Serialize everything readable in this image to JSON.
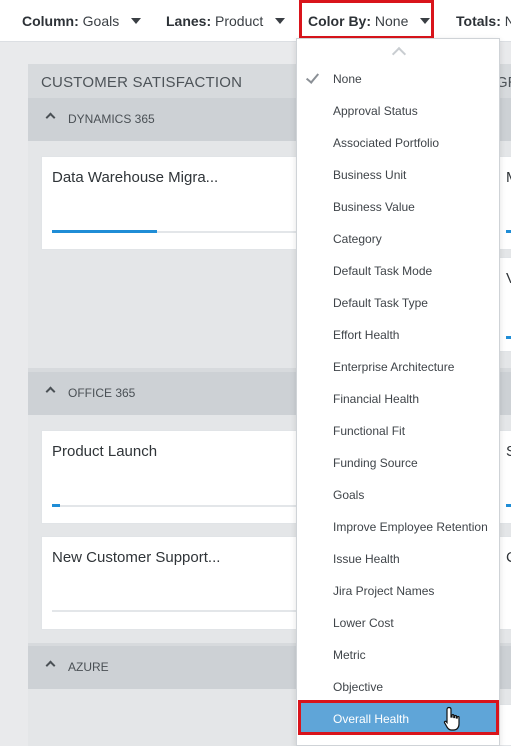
{
  "toolbar": {
    "column_label": "Column:",
    "column_value": "Goals",
    "lanes_label": "Lanes:",
    "lanes_value": "Product",
    "colorby_label": "Color By:",
    "colorby_value": "None",
    "totals_label": "Totals:",
    "totals_value": "N"
  },
  "columns": [
    {
      "title": "CUSTOMER SATISFACTION"
    },
    {
      "title": "GR"
    }
  ],
  "lanes": [
    {
      "label": "DYNAMICS 365",
      "cards": [
        {
          "title": "Data Warehouse Migra...",
          "progress": 0.42
        }
      ],
      "right_cards": [
        {
          "title": "M"
        },
        {
          "title": "V"
        }
      ]
    },
    {
      "label": "OFFICE 365",
      "cards": [
        {
          "title": "Product Launch",
          "progress": 0.03
        },
        {
          "title": "New Customer Support...",
          "progress": 0
        }
      ],
      "right_cards": [
        {
          "title": "S"
        },
        {
          "title": "C"
        }
      ]
    },
    {
      "label": "AZURE",
      "cards": [],
      "right_cards": []
    }
  ],
  "color_by_menu": {
    "items": [
      "None",
      "Approval Status",
      "Associated Portfolio",
      "Business Unit",
      "Business Value",
      "Category",
      "Default Task Mode",
      "Default Task Type",
      "Effort Health",
      "Enterprise Architecture",
      "Financial Health",
      "Functional Fit",
      "Funding Source",
      "Goals",
      "Improve Employee Retention",
      "Issue Health",
      "Jira Project Names",
      "Lower Cost",
      "Metric",
      "Objective",
      "Overall Health"
    ],
    "checked": "None",
    "hovered": "Overall Health"
  },
  "colors": {
    "highlight": "#d9141b",
    "selected_item": "#5fa5d8",
    "progress": "#1f8dd6"
  }
}
